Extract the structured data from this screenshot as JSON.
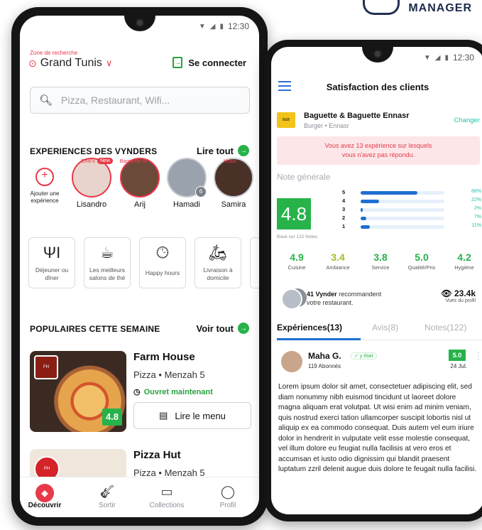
{
  "brand": {
    "label": "MANAGER"
  },
  "phone1": {
    "status": {
      "time": "12:30"
    },
    "zone_label": "Zone de recherche",
    "zone_value": "Grand Tunis",
    "login_label": "Se connecter",
    "search_placeholder": "Pizza, Restaurant, Wifi...",
    "experiences": {
      "title": "EXPERIENCES DES VYNDERS",
      "link": "Lire tout",
      "add_label_1": "Ajouter une",
      "add_label_2": "expérience",
      "stories": [
        {
          "name": "Lisandro",
          "sub": "Chili's",
          "badge": "New"
        },
        {
          "name": "Arij",
          "sub": "Baguette et ..."
        },
        {
          "name": "Hamadi",
          "sub": "",
          "count": "6"
        },
        {
          "name": "Samira",
          "sub": "Hobo"
        }
      ]
    },
    "categories": [
      {
        "label": "Déjeuner ou dîner",
        "icon": "fork-knife-icon"
      },
      {
        "label": "Les meilleurs salons de thé",
        "icon": "tea-cup-icon"
      },
      {
        "label": "Happy hours",
        "icon": "clock-drink-icon"
      },
      {
        "label": "Livraison à domicile",
        "icon": "delivery-scooter-icon"
      }
    ],
    "popular": {
      "title": "POPULAIRES CETTE SEMAINE",
      "link": "Voir tout",
      "cards": [
        {
          "title": "Farm House",
          "meta": "Pizza • Menzah 5",
          "status": "Ouvret maintenant",
          "score": "4.8",
          "menu": "Lire le menu"
        },
        {
          "title": "Pizza Hut",
          "meta": "Pizza • Menzah 5"
        }
      ]
    },
    "tabbar": [
      {
        "label": "Découvrir",
        "active": true
      },
      {
        "label": "Sortir"
      },
      {
        "label": "Collections"
      },
      {
        "label": "Profil"
      }
    ]
  },
  "phone2": {
    "status": {
      "time": "12:30"
    },
    "title": "Satisfaction des clients",
    "restaurant": {
      "name": "Baguette & Baguette Ennasr",
      "category": "Burger",
      "location": "Ennasr",
      "change": "Changer"
    },
    "alert_1": "Vous avez 13 expérience sur lesquels",
    "alert_2": "vous n'avez pas répondu.",
    "note_title": "Note générale",
    "overall": "4.8",
    "based_on": "Basé sur 122 Notes",
    "distribution": [
      {
        "star": "5",
        "pct": "68%",
        "frac": 0.68
      },
      {
        "star": "4",
        "pct": "22%",
        "frac": 0.22
      },
      {
        "star": "3",
        "pct": "2%",
        "frac": 0.02
      },
      {
        "star": "2",
        "pct": "7%",
        "frac": 0.07
      },
      {
        "star": "1",
        "pct": "11%",
        "frac": 0.11
      }
    ],
    "subscores": [
      {
        "value": "4.9",
        "label": "Cuisine",
        "color": "#27b24a"
      },
      {
        "value": "3.4",
        "label": "Ambiance",
        "color": "#9bbf2a"
      },
      {
        "value": "3.8",
        "label": "Service",
        "color": "#27b24a"
      },
      {
        "value": "5.0",
        "label": "Qualité/Prix",
        "color": "#27b24a"
      },
      {
        "value": "4.2",
        "label": "Hygiène",
        "color": "#27b24a"
      }
    ],
    "vynder": {
      "count": "41 Vynder",
      "text_1": " recommandent",
      "text_2": "votre restaurant.",
      "views": "23.4k",
      "views_label": "Vues du profil"
    },
    "tabs": [
      {
        "label": "Expériences(13)",
        "active": true
      },
      {
        "label": "Avis(8)"
      },
      {
        "label": "Notes(122)"
      }
    ],
    "review": {
      "name": "Maha G.",
      "was_there": "y était",
      "followers": "119 Abonnés",
      "score": "5.0",
      "date": "24 Jul.",
      "text": "Lorem ipsum dolor sit amet, consectetuer adipiscing elit, sed diam nonummy nibh euismod tincidunt ut laoreet dolore magna aliquam erat volutpat. Ut wisi enim ad minim veniam, quis nostrud exerci tation ullamcorper suscipit lobortis nisl ut aliquip ex ea commodo consequat. Duis autem vel eum iriure dolor in hendrerit in vulputate velit esse molestie consequat, vel illum dolore eu feugiat nulla facilisis at vero eros et accumsan et iusto odio dignissim qui blandit praesent luptatum zzril delenit augue duis dolore te feugait nulla facilisi."
    }
  }
}
